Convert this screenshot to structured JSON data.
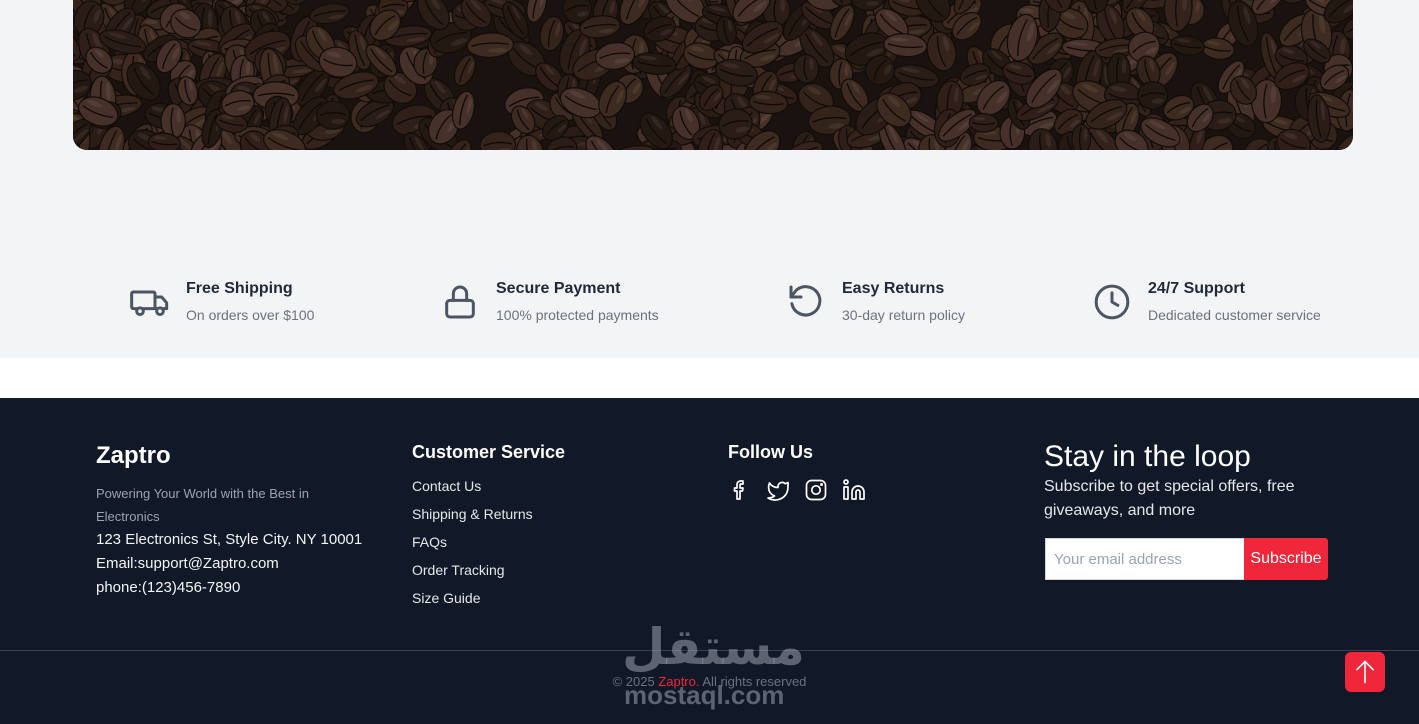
{
  "features": [
    {
      "title": "Free Shipping",
      "desc": "On orders over $100",
      "icon": "truck-icon"
    },
    {
      "title": "Secure Payment",
      "desc": "100% protected payments",
      "icon": "lock-icon"
    },
    {
      "title": "Easy Returns",
      "desc": "30-day return policy",
      "icon": "rotate-ccw-icon"
    },
    {
      "title": "24/7 Support",
      "desc": "Dedicated customer service",
      "icon": "clock-icon"
    }
  ],
  "footer": {
    "brand": "Zaptro",
    "tagline": "Powering Your World with the Best in Electronics",
    "address": "123 Electronics St, Style City. NY 10001",
    "email": "Email:support@Zaptro.com",
    "phone": "phone:(123)456-7890",
    "customer_service": {
      "title": "Customer Service",
      "links": [
        "Contact Us",
        "Shipping & Returns",
        "FAQs",
        "Order Tracking",
        "Size Guide"
      ]
    },
    "follow": {
      "title": "Follow Us",
      "icons": [
        "facebook-icon",
        "twitter-icon",
        "instagram-icon",
        "linkedin-icon"
      ]
    },
    "newsletter": {
      "title": "Stay in the loop",
      "desc": "Subscribe to get special offers, free giveaways, and more",
      "placeholder": "Your email address",
      "button": "Subscribe"
    },
    "copyright": {
      "prefix": "© 2025 ",
      "brand": "Zaptro.",
      "suffix": " All rights reserved"
    }
  },
  "watermark": {
    "arabic": "مستقل",
    "latin": "mostaql.com"
  },
  "colors": {
    "accent": "#f0263a",
    "footer_bg": "#111827",
    "page_bg": "#f3f4f6",
    "icon": "#4b5563"
  }
}
